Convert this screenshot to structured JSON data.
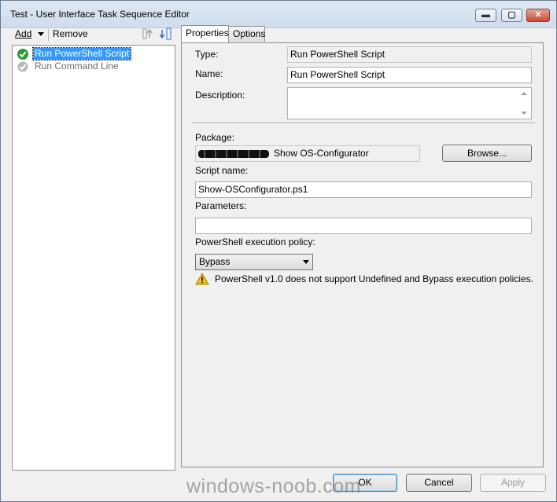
{
  "window": {
    "title": "Test - User Interface Task Sequence Editor",
    "controls": {
      "minimize": "▬",
      "maximize": "▢",
      "close": "✕"
    }
  },
  "toolbar": {
    "add_label": "Add",
    "remove_label": "Remove",
    "add_dropdown_icon": "chevron-down-icon"
  },
  "tree": {
    "items": [
      {
        "label": "Run PowerShell Script",
        "status": "success",
        "selected": true
      },
      {
        "label": "Run Command Line",
        "status": "disabled",
        "selected": false
      }
    ]
  },
  "tabs": {
    "properties": "Properties",
    "options": "Options"
  },
  "properties": {
    "type_label": "Type:",
    "type_value": "Run PowerShell Script",
    "name_label": "Name:",
    "name_value": "Run PowerShell Script",
    "description_label": "Description:",
    "description_value": "",
    "package_label": "Package:",
    "package_value": "Show OS-Configurator",
    "browse_label": "Browse...",
    "script_name_label": "Script name:",
    "script_name_value": "Show-OSConfigurator.ps1",
    "parameters_label": "Parameters:",
    "parameters_value": "",
    "policy_label": "PowerShell execution policy:",
    "policy_value": "Bypass",
    "warning_text": "PowerShell v1.0 does not support Undefined and Bypass execution policies."
  },
  "footer": {
    "ok_label": "OK",
    "cancel_label": "Cancel",
    "apply_label": "Apply"
  },
  "watermark": "windows-noob.com",
  "colors": {
    "selection": "#3399ff",
    "success_icon": "#2f9a3a",
    "warning_icon": "#f2c200"
  }
}
